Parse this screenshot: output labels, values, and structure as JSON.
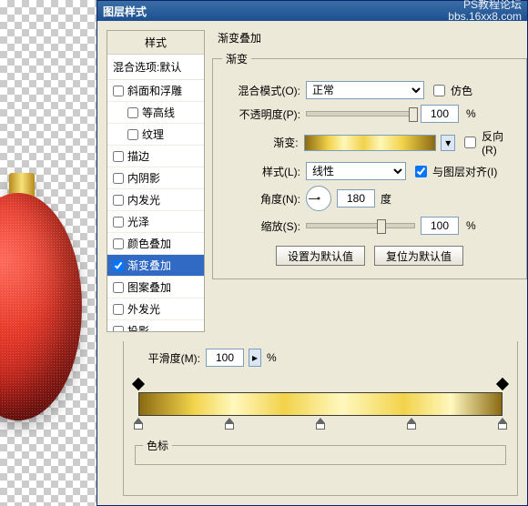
{
  "titlebar": {
    "title": "图层样式",
    "watermark_line1": "PS教程论坛",
    "watermark_line2": "bbs.16xx8.com"
  },
  "styles_panel": {
    "header": "样式",
    "subheader": "混合选项:默认",
    "items": [
      {
        "label": "斜面和浮雕",
        "checked": false,
        "indent": false
      },
      {
        "label": "等高线",
        "checked": false,
        "indent": true
      },
      {
        "label": "纹理",
        "checked": false,
        "indent": true
      },
      {
        "label": "描边",
        "checked": false,
        "indent": false
      },
      {
        "label": "内阴影",
        "checked": false,
        "indent": false
      },
      {
        "label": "内发光",
        "checked": false,
        "indent": false
      },
      {
        "label": "光泽",
        "checked": false,
        "indent": false
      },
      {
        "label": "颜色叠加",
        "checked": false,
        "indent": false
      },
      {
        "label": "渐变叠加",
        "checked": true,
        "indent": false,
        "selected": true
      },
      {
        "label": "图案叠加",
        "checked": false,
        "indent": false
      },
      {
        "label": "外发光",
        "checked": false,
        "indent": false
      },
      {
        "label": "投影",
        "checked": false,
        "indent": false
      }
    ]
  },
  "main": {
    "section_title": "渐变叠加",
    "legend": "渐变",
    "blend_mode": {
      "label": "混合模式(O):",
      "value": "正常"
    },
    "dither": {
      "label": "仿色",
      "checked": false
    },
    "opacity": {
      "label": "不透明度(P):",
      "value": "100",
      "unit": "%",
      "slider_pct": 100
    },
    "gradient": {
      "label": "渐变:"
    },
    "reverse": {
      "label": "反向(R)",
      "checked": false
    },
    "style": {
      "label": "样式(L):",
      "value": "线性"
    },
    "align": {
      "label": "与图层对齐(I)",
      "checked": true
    },
    "angle": {
      "label": "角度(N):",
      "value": "180",
      "unit": "度"
    },
    "scale": {
      "label": "缩放(S):",
      "value": "100",
      "unit": "%",
      "slider_pct": 65
    },
    "btn_default": "设置为默认值",
    "btn_reset": "复位为默认值"
  },
  "gradient_editor": {
    "smooth_label": "平滑度(M):",
    "smooth_value": "100",
    "smooth_unit": "%",
    "top_stops_pct": [
      0,
      100
    ],
    "bottom_stops_pct": [
      0,
      25,
      50,
      75,
      100
    ],
    "sebiao_legend": "色标"
  }
}
